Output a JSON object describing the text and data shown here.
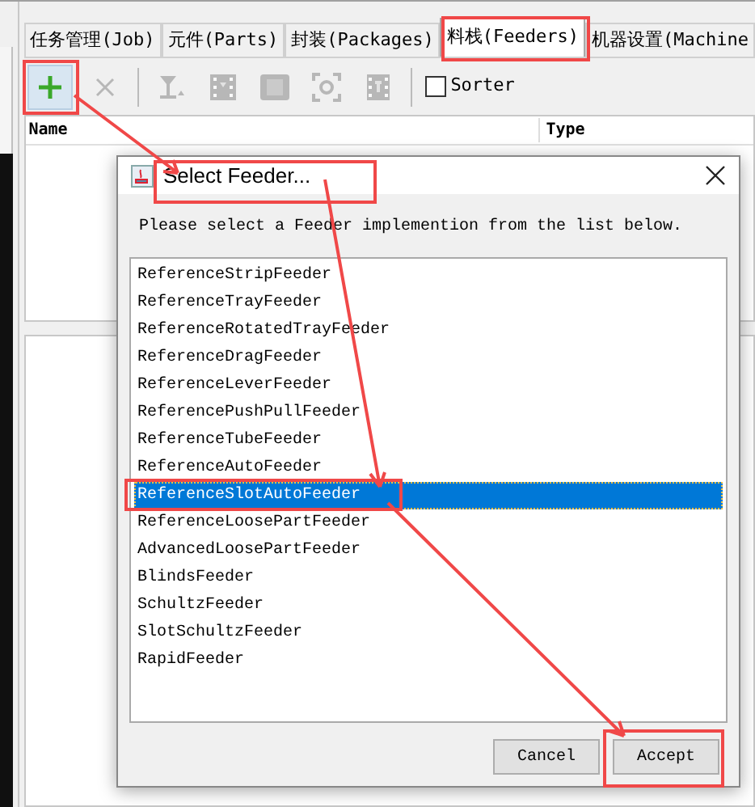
{
  "tabs": [
    {
      "label": "任务管理(Job)",
      "selected": false
    },
    {
      "label": "元件(Parts)",
      "selected": false
    },
    {
      "label": "封装(Packages)",
      "selected": false
    },
    {
      "label": "料栈(Feeders)",
      "selected": true
    },
    {
      "label": "机器设置(Machine",
      "selected": false
    }
  ],
  "toolbar": {
    "buttons": [
      {
        "kind": "add",
        "disabled": false
      },
      {
        "kind": "delete",
        "disabled": true
      },
      {
        "kind": "pick",
        "disabled": true
      },
      {
        "kind": "feed",
        "disabled": true
      },
      {
        "kind": "frame",
        "disabled": true
      },
      {
        "kind": "view",
        "disabled": true
      },
      {
        "kind": "film",
        "disabled": true
      }
    ],
    "sorter": {
      "label": "Sorter",
      "checked": false
    }
  },
  "table": {
    "columns": [
      "Name",
      "Type"
    ]
  },
  "dialog": {
    "title": "Select Feeder...",
    "instruction": "Please select a Feeder implemention from the list below.",
    "items": [
      {
        "label": "ReferenceStripFeeder",
        "selected": false
      },
      {
        "label": "ReferenceTrayFeeder",
        "selected": false
      },
      {
        "label": "ReferenceRotatedTrayFeeder",
        "selected": false
      },
      {
        "label": "ReferenceDragFeeder",
        "selected": false
      },
      {
        "label": "ReferenceLeverFeeder",
        "selected": false
      },
      {
        "label": "ReferencePushPullFeeder",
        "selected": false
      },
      {
        "label": "ReferenceTubeFeeder",
        "selected": false
      },
      {
        "label": "ReferenceAutoFeeder",
        "selected": false
      },
      {
        "label": "ReferenceSlotAutoFeeder",
        "selected": true
      },
      {
        "label": "ReferenceLoosePartFeeder",
        "selected": false
      },
      {
        "label": "AdvancedLoosePartFeeder",
        "selected": false
      },
      {
        "label": "BlindsFeeder",
        "selected": false
      },
      {
        "label": "SchultzFeeder",
        "selected": false
      },
      {
        "label": "SlotSchultzFeeder",
        "selected": false
      },
      {
        "label": "RapidFeeder",
        "selected": false
      }
    ],
    "buttons": [
      "Cancel",
      "Accept"
    ]
  }
}
